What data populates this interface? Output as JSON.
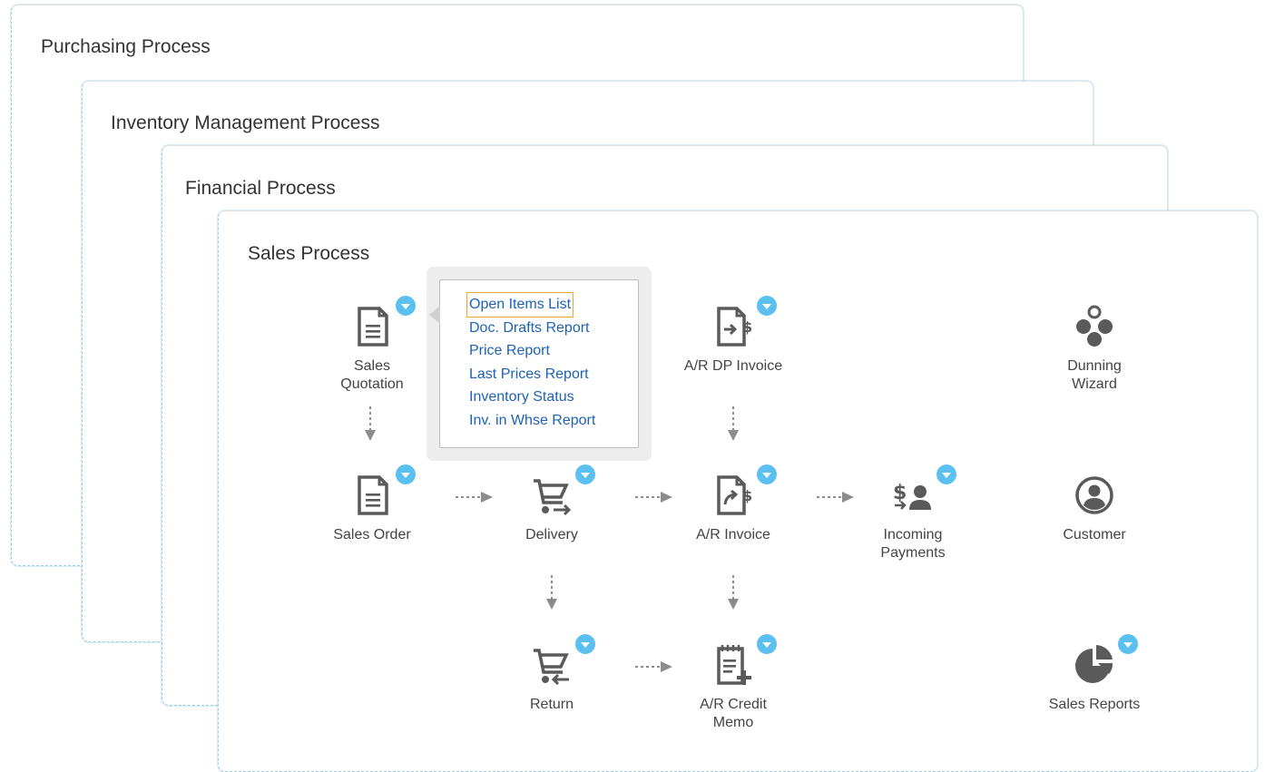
{
  "cards": {
    "purchasing": "Purchasing Process",
    "inventory": "Inventory Management Process",
    "financial": "Financial Process",
    "sales": "Sales Process"
  },
  "nodes": {
    "sales_quotation": "Sales\nQuotation",
    "ar_dp_invoice": "A/R DP Invoice",
    "dunning_wizard": "Dunning\nWizard",
    "sales_order": "Sales Order",
    "delivery": "Delivery",
    "ar_invoice": "A/R Invoice",
    "incoming_payments": "Incoming\nPayments",
    "customer": "Customer",
    "return": "Return",
    "ar_credit_memo": "A/R Credit\nMemo",
    "sales_reports": "Sales Reports"
  },
  "popup": {
    "items": [
      "Open Items List",
      "Doc. Drafts Report",
      "Price Report",
      "Last Prices Report",
      "Inventory Status",
      "Inv. in Whse Report"
    ]
  },
  "colors": {
    "icon": "#5a5a5a",
    "accent": "#5bc0f0",
    "link": "#1d62b5",
    "arrow": "#8c8c8c",
    "focus": "#f0a62a"
  }
}
